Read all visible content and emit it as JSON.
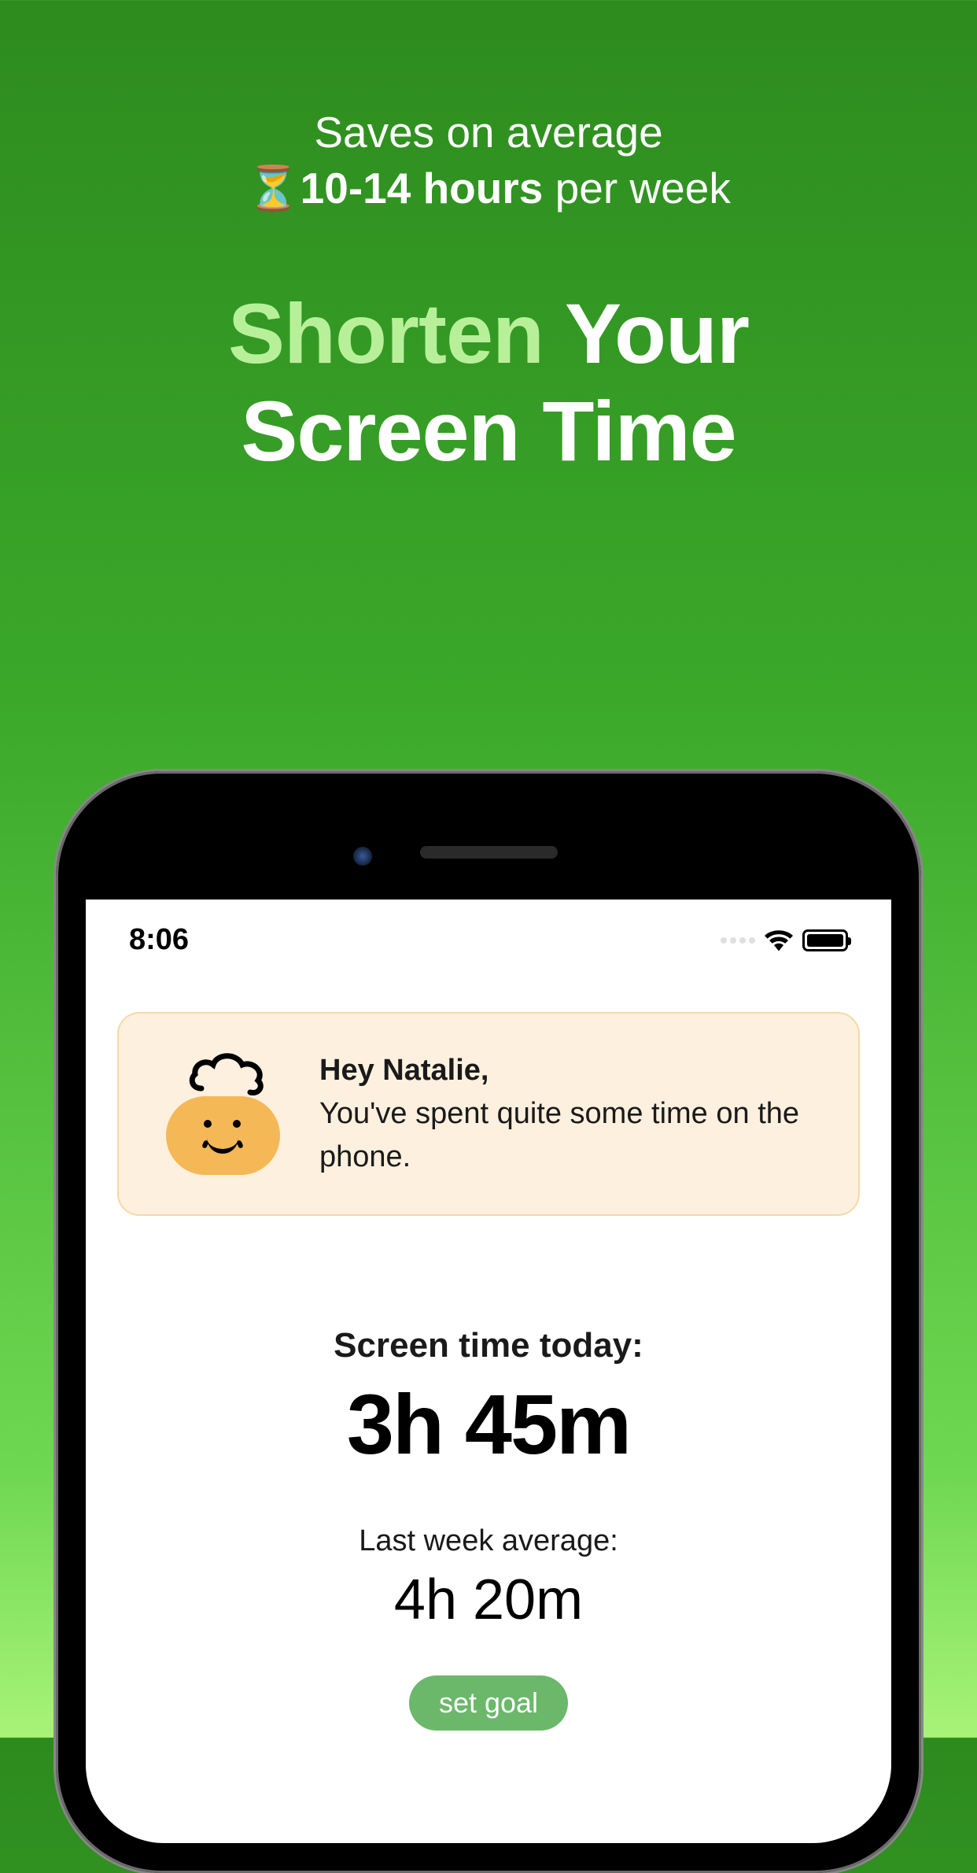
{
  "promo": {
    "subtitle_line1": "Saves on average",
    "hourglass_emoji": "⏳",
    "subtitle_bold": "10-14 hours",
    "subtitle_suffix": " per week",
    "title_accent": "Shorten",
    "title_rest_line1": " Your",
    "title_line2": "Screen Time"
  },
  "statusbar": {
    "time": "8:06"
  },
  "greeting": {
    "name_line": "Hey Natalie,",
    "message": "You've spent quite some time on the phone."
  },
  "stats": {
    "today_label": "Screen time today:",
    "today_value": "3h 45m",
    "lastweek_label": "Last week average:",
    "lastweek_value": "4h 20m"
  },
  "actions": {
    "set_goal_label": "set goal"
  }
}
